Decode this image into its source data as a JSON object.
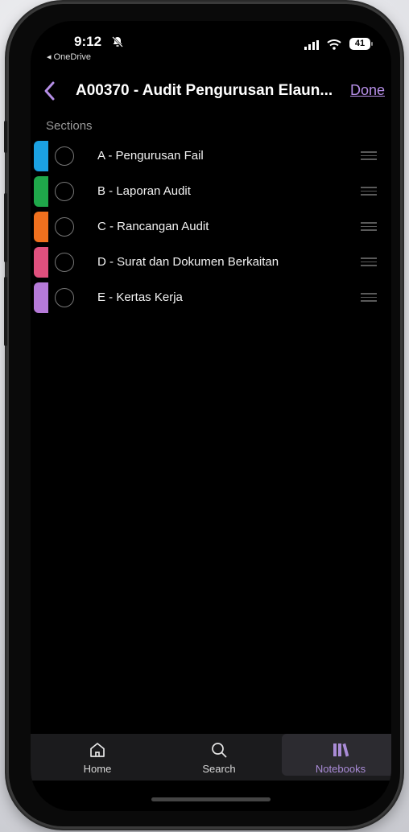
{
  "status": {
    "time": "9:12",
    "back_app": "◂ OneDrive",
    "battery": "41"
  },
  "nav": {
    "title": "A00370 - Audit Pengurusan Elaun...",
    "done_label": "Done"
  },
  "sections_label": "Sections",
  "sections": [
    {
      "label": "A - Pengurusan Fail",
      "color": "#1ba1e2"
    },
    {
      "label": "B - Laporan Audit",
      "color": "#1fa84a"
    },
    {
      "label": "C - Rancangan Audit",
      "color": "#f0701e"
    },
    {
      "label": "D - Surat dan Dokumen Berkaitan",
      "color": "#e0507e"
    },
    {
      "label": "E - Kertas Kerja",
      "color": "#b57ad8"
    }
  ],
  "tabbar": {
    "home": {
      "label": "Home",
      "icon": "home-icon"
    },
    "search": {
      "label": "Search",
      "icon": "search-icon"
    },
    "notebooks": {
      "label": "Notebooks",
      "icon": "notebooks-icon"
    }
  },
  "colors": {
    "accent": "#b58ee6"
  }
}
